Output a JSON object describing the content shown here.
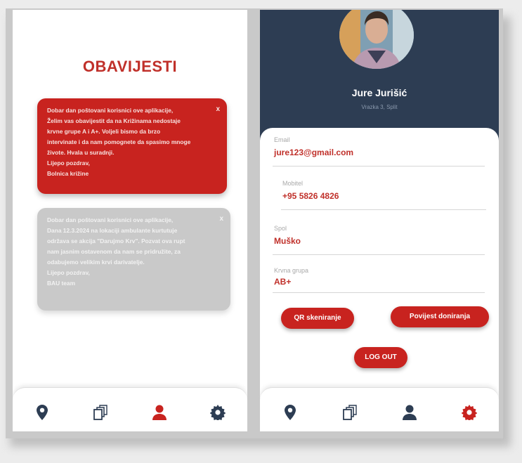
{
  "colors": {
    "accent": "#c8231f",
    "navy": "#2d3d53",
    "active_icon": "#c8231f",
    "inactive_icon": "#2d3d53"
  },
  "notifications_screen": {
    "title": "OBAVIJESTI",
    "cards": [
      {
        "state": "unread",
        "close": "x",
        "text": "Dobar dan poštovani korisnici ove aplikacije,\nŽelim vas obavijestit da na Križinama nedostaje\nkrvne grupe A i A+. Voljeli bismo da brzo\nintervinate i da nam pomognete da spasimo mnoge\nživote. Hvala u suradnji.\nLijepo pozdrav,\nBolnica križine"
      },
      {
        "state": "read",
        "close": "x",
        "text": "Dobar dan poštovani korisnici ove aplikacije,\nDana 12.3.2024 na lokaciji ambulante kurtutuje\nodržava se akcija \"Darujmo Krv\". Pozvat ova rupt\nnam jasnim ostavenom da nam se pridružite, za\nodabujemo velikim krvi darivatelje.\nLijepo pozdrav,\nBAU team"
      }
    ]
  },
  "profile_screen": {
    "name": "Jure Jurišić",
    "location": "Vrazka 3, Split",
    "fields": [
      {
        "label": "Email",
        "value": "jure123@gmail.com"
      },
      {
        "label": "Mobitel",
        "value": "+95 5826 4826"
      },
      {
        "label": "Spol",
        "value": "Muško"
      },
      {
        "label": "Krvna grupa",
        "value": "AB+"
      }
    ],
    "buttons": {
      "qr": "QR skeniranje",
      "history": "Povijest doniranja",
      "logout": "LOG OUT"
    }
  },
  "nav": {
    "items": [
      {
        "icon": "map-pin-icon"
      },
      {
        "icon": "cards-icon"
      },
      {
        "icon": "user-icon"
      },
      {
        "icon": "gear-icon"
      }
    ],
    "left_active": "user-icon",
    "right_active": "gear-icon"
  }
}
